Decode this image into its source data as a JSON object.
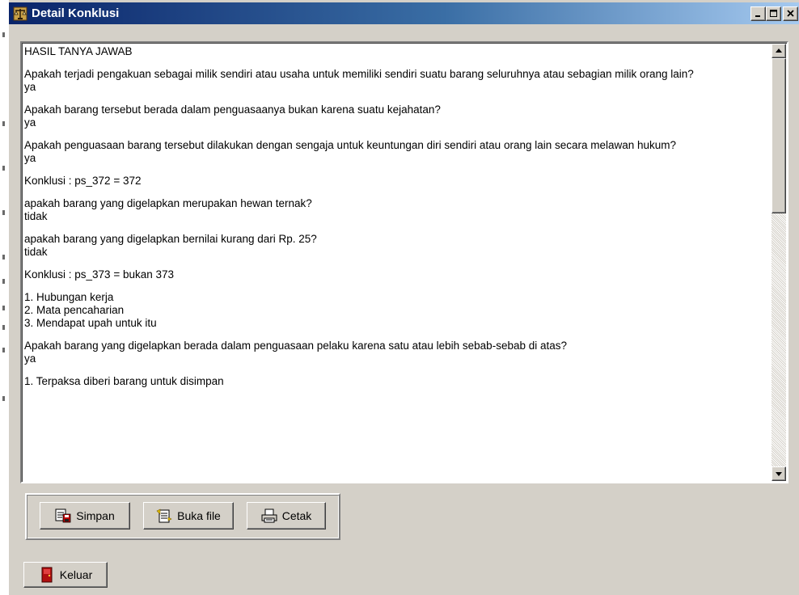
{
  "window": {
    "title": "Detail Konklusi",
    "minimize_label": "_",
    "maximize_label": "□",
    "close_label": "×"
  },
  "memo": {
    "lines": [
      "HASIL TANYA JAWAB",
      "",
      "Apakah terjadi pengakuan sebagai milik sendiri atau usaha untuk memiliki sendiri suatu barang seluruhnya atau sebagian milik orang lain?",
      "ya",
      "",
      "Apakah barang tersebut berada dalam penguasaanya bukan karena suatu kejahatan?",
      "ya",
      "",
      "Apakah penguasaan barang tersebut dilakukan dengan sengaja untuk keuntungan diri sendiri atau orang lain secara melawan hukum?",
      "ya",
      "",
      "Konklusi : ps_372 = 372",
      "",
      "apakah barang yang digelapkan merupakan hewan ternak?",
      "tidak",
      "",
      "apakah barang yang digelapkan bernilai kurang dari Rp. 25?",
      "tidak",
      "",
      "Konklusi : ps_373 = bukan 373",
      "",
      "1. Hubungan kerja",
      "2. Mata pencaharian",
      "3. Mendapat upah untuk itu",
      "",
      "Apakah barang yang digelapkan berada dalam penguasaan pelaku karena satu atau lebih sebab-sebab di atas?",
      "ya",
      "",
      "1. Terpaksa diberi barang untuk disimpan"
    ],
    "scroll_position": 0.0
  },
  "buttons": {
    "simpan": "Simpan",
    "buka_file": "Buka file",
    "cetak": "Cetak",
    "keluar": "Keluar"
  },
  "icons": {
    "title": "scales-icon",
    "simpan": "save-icon",
    "buka_file": "open-file-icon",
    "cetak": "printer-icon",
    "keluar": "exit-door-icon"
  },
  "colors": {
    "titlebar_start": "#0a246a",
    "titlebar_end": "#a6caf0",
    "face": "#d4d0c8"
  }
}
